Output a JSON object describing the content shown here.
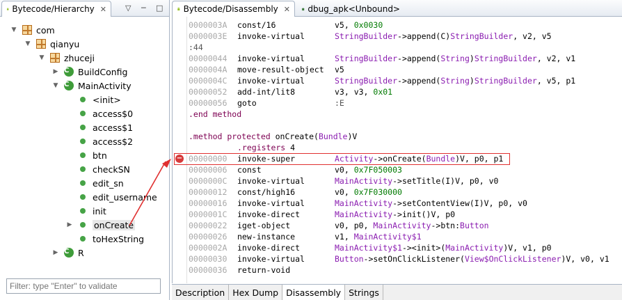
{
  "left_pane": {
    "tab_title": "Bytecode/Hierarchy",
    "tab_close": "✕",
    "view_menu": "▽",
    "minimize": "─",
    "maximize": "□",
    "filter_placeholder": "Filter: type \"Enter\" to validate",
    "tree": [
      {
        "label": "com",
        "icon": "package-icon",
        "twisty": "▼",
        "depth": 0
      },
      {
        "label": "qianyu",
        "icon": "package-icon",
        "twisty": "▼",
        "depth": 1
      },
      {
        "label": "zhuceji",
        "icon": "package-icon",
        "twisty": "▼",
        "depth": 2
      },
      {
        "label": "BuildConfig",
        "icon": "class-icon",
        "twisty": "▶",
        "depth": 3
      },
      {
        "label": "MainActivity",
        "icon": "class-icon",
        "twisty": "▼",
        "depth": 3
      },
      {
        "label": "<init>",
        "icon": "method-icon",
        "twisty": "",
        "depth": 4
      },
      {
        "label": "access$0",
        "icon": "method-icon",
        "twisty": "",
        "depth": 4
      },
      {
        "label": "access$1",
        "icon": "method-icon",
        "twisty": "",
        "depth": 4
      },
      {
        "label": "access$2",
        "icon": "method-icon",
        "twisty": "",
        "depth": 4
      },
      {
        "label": "btn",
        "icon": "method-icon",
        "twisty": "",
        "depth": 4
      },
      {
        "label": "checkSN",
        "icon": "method-icon",
        "twisty": "",
        "depth": 4
      },
      {
        "label": "edit_sn",
        "icon": "method-icon",
        "twisty": "",
        "depth": 4
      },
      {
        "label": "edit_username",
        "icon": "method-icon",
        "twisty": "",
        "depth": 4
      },
      {
        "label": "init",
        "icon": "method-icon",
        "twisty": "",
        "depth": 4
      },
      {
        "label": "onCreate",
        "icon": "method-icon",
        "twisty": "▶",
        "depth": 4,
        "selected": true
      },
      {
        "label": "toHexString",
        "icon": "method-icon",
        "twisty": "",
        "depth": 4
      },
      {
        "label": "R",
        "icon": "class-icon",
        "twisty": "▶",
        "depth": 3
      }
    ]
  },
  "right_pane": {
    "tabs": [
      {
        "label": "Bytecode/Disassembly",
        "close": "✕",
        "active": true
      },
      {
        "label": "dbug_apk<Unbound>",
        "active": false
      }
    ],
    "bottom_tabs": [
      "Description",
      "Hex Dump",
      "Disassembly",
      "Strings"
    ],
    "active_bottom_tab": "Disassembly",
    "error_marker": "−",
    "lines": [
      {
        "addr": "0000003A",
        "op": "const/16",
        "arg": [
          [
            "v5, ",
            ""
          ],
          [
            "0x0030",
            "num"
          ]
        ]
      },
      {
        "addr": "0000003E",
        "op": "invoke-virtual",
        "arg": [
          [
            "StringBuilder",
            "typ"
          ],
          [
            "->append(C)",
            ""
          ],
          [
            "StringBuilder",
            "typ"
          ],
          [
            ", v2, v5",
            ""
          ]
        ]
      },
      {
        "addr": "",
        "op": "",
        "raw": [
          [
            ":44",
            "lbl"
          ]
        ]
      },
      {
        "addr": "00000044",
        "op": "invoke-virtual",
        "arg": [
          [
            "StringBuilder",
            "typ"
          ],
          [
            "->append(",
            ""
          ],
          [
            "String",
            "typ"
          ],
          [
            ")",
            ""
          ],
          [
            "StringBuilder",
            "typ"
          ],
          [
            ", v2, v1",
            ""
          ]
        ]
      },
      {
        "addr": "0000004A",
        "op": "move-result-object",
        "arg": [
          [
            "v5",
            ""
          ]
        ]
      },
      {
        "addr": "0000004C",
        "op": "invoke-virtual",
        "arg": [
          [
            "StringBuilder",
            "typ"
          ],
          [
            "->append(",
            ""
          ],
          [
            "String",
            "typ"
          ],
          [
            ")",
            ""
          ],
          [
            "StringBuilder",
            "typ"
          ],
          [
            ", v5, p1",
            ""
          ]
        ]
      },
      {
        "addr": "00000052",
        "op": "add-int/lit8",
        "arg": [
          [
            "v3, v3, ",
            ""
          ],
          [
            "0x01",
            "num"
          ]
        ]
      },
      {
        "addr": "00000056",
        "op": "goto",
        "arg": [
          [
            ":E",
            "lbl"
          ]
        ]
      },
      {
        "addr": "",
        "op": "",
        "raw": [
          [
            ".end method",
            "kw"
          ]
        ]
      },
      {
        "addr": "",
        "op": "",
        "raw": [
          [
            "",
            ""
          ]
        ]
      },
      {
        "addr": "",
        "op": "",
        "raw": [
          [
            ".method protected ",
            "kw"
          ],
          [
            "onCreate(",
            ""
          ],
          [
            "Bundle",
            "typ"
          ],
          [
            ")V",
            ""
          ]
        ]
      },
      {
        "addr": "",
        "op": "",
        "indent": [
          [
            ".registers ",
            "kw"
          ],
          [
            "4",
            ""
          ]
        ]
      },
      {
        "addr": "00000000",
        "op": "invoke-super",
        "arg": [
          [
            "Activity",
            "typ"
          ],
          [
            "->onCreate(",
            ""
          ],
          [
            "Bundle",
            "typ"
          ],
          [
            ")V, p0, p1",
            ""
          ]
        ],
        "error": true
      },
      {
        "addr": "00000006",
        "op": "const",
        "arg": [
          [
            "v0, ",
            ""
          ],
          [
            "0x7F050003",
            "num"
          ]
        ]
      },
      {
        "addr": "0000000C",
        "op": "invoke-virtual",
        "arg": [
          [
            "MainActivity",
            "typ"
          ],
          [
            "->setTitle(I)V, p0, v0",
            ""
          ]
        ]
      },
      {
        "addr": "00000012",
        "op": "const/high16",
        "arg": [
          [
            "v0, ",
            ""
          ],
          [
            "0x7F030000",
            "num"
          ]
        ]
      },
      {
        "addr": "00000016",
        "op": "invoke-virtual",
        "arg": [
          [
            "MainActivity",
            "typ"
          ],
          [
            "->setContentView(I)V, p0, v0",
            ""
          ]
        ]
      },
      {
        "addr": "0000001C",
        "op": "invoke-direct",
        "arg": [
          [
            "MainActivity",
            "typ"
          ],
          [
            "->init()V, p0",
            ""
          ]
        ]
      },
      {
        "addr": "00000022",
        "op": "iget-object",
        "arg": [
          [
            "v0, p0, ",
            ""
          ],
          [
            "MainActivity",
            "typ"
          ],
          [
            "->btn:",
            ""
          ],
          [
            "Button",
            "typ"
          ]
        ]
      },
      {
        "addr": "00000026",
        "op": "new-instance",
        "arg": [
          [
            "v1, ",
            ""
          ],
          [
            "MainActivity$1",
            "typ"
          ]
        ]
      },
      {
        "addr": "0000002A",
        "op": "invoke-direct",
        "arg": [
          [
            "MainActivity$1",
            "typ"
          ],
          [
            "-><init>(",
            ""
          ],
          [
            "MainActivity",
            "typ"
          ],
          [
            ")V, v1, p0",
            ""
          ]
        ]
      },
      {
        "addr": "00000030",
        "op": "invoke-virtual",
        "arg": [
          [
            "Button",
            "typ"
          ],
          [
            "->setOnClickListener(",
            ""
          ],
          [
            "View$OnClickListener",
            "typ"
          ],
          [
            ")V, v0, v1",
            ""
          ]
        ]
      },
      {
        "addr": "00000036",
        "op": "return-void",
        "arg": []
      }
    ]
  },
  "colors": {
    "type": "#8a1cb0",
    "number": "#007a00",
    "keyword": "#7d0052",
    "address": "#a8a8a8",
    "annotation_red": "#e03030"
  }
}
